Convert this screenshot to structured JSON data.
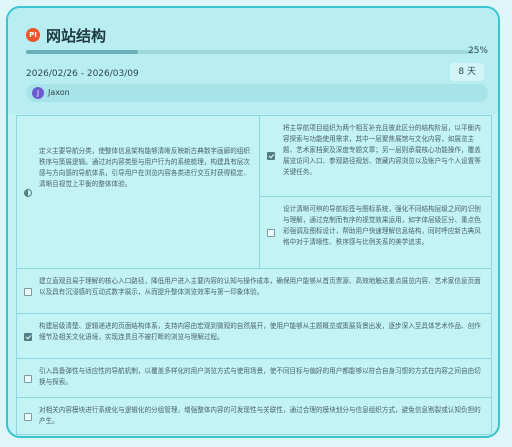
{
  "header": {
    "logo_text": "PI",
    "title": "网站结构",
    "progress_label": "25%",
    "progress_fraction": 0.25,
    "date_range": "2026/02/26 - 2026/03/09",
    "duration": "8 天",
    "user": {
      "initial": "J",
      "name": "Jaxon"
    }
  },
  "tasks": [
    {
      "status": "partial",
      "text": "定义主要导航分类，使整体信息架构能够清晰反映新古典数字画廊的组织秩序与策展逻辑。通过对内容类型与用户行为的系统梳理，构建具有层次感与方向感的导航体系，引导用户在浏览内容各类进行交互时获得稳定、清晰且视觉上平衡的整体体验。"
    },
    {
      "status": "checked",
      "text": "将主导航项目组织为两个相互补充且彼此区分的结构阶层，以平衡内容探索与功能使用需求，其中一层聚焦展馆与文化内容，如展览主题、艺术家档案及深度专题文章；另一层则承载核心功能操作，覆盖展览访问入口、参观路径规划、馆藏内容浏览以及账户与个人设置等关键任务。"
    },
    {
      "status": "unchecked",
      "text": "设计清晰可辨的导航标签与图标系统，强化不同结构层级之间的识别与理解，通过克制而有序的视觉效果运用，如字体层级区分、重点色彩强调及图标设计，帮助用户快速理解信息结构，同时呼应新古典风格中对于清晰性、秩序感与比例关系的美学追求。"
    },
    {
      "status": "unchecked",
      "text": "建立直观且易于理解的核心入口路径，降低用户进入主要内容的认知与操作成本，确保用户能够从首页票源、高效地触达重点展览内容、艺术家信息页面以及具有沉浸感的互动式数字展示，从而提升整体浏览效率与第一印象体验。"
    },
    {
      "status": "checked",
      "text": "构建层级清楚、逻辑递进的页面结构体系，支持内容由宏观到微观的自然展开，使用户能够从主题概览或策展背景出发，逐步深入至具体艺术作品、创作细节及相关文化语境，实现连贯且不被打断的浏览与理解过程。"
    },
    {
      "status": "unchecked",
      "text": "引入具备弹性与适应性的导航机制，以覆盖多样化的用户浏览方式与使用场景，使不同目标与偏好的用户都能够以符合自身习惯的方式在内容之间自由切换与探索。"
    },
    {
      "status": "unchecked",
      "text": "对相关内容模块进行系统化与逻辑化的分组管理，增强整体内容的可发现性与关联性，通过合理的模块划分与信息组织方式，避免信息割裂或认知负担的产生。"
    }
  ]
}
